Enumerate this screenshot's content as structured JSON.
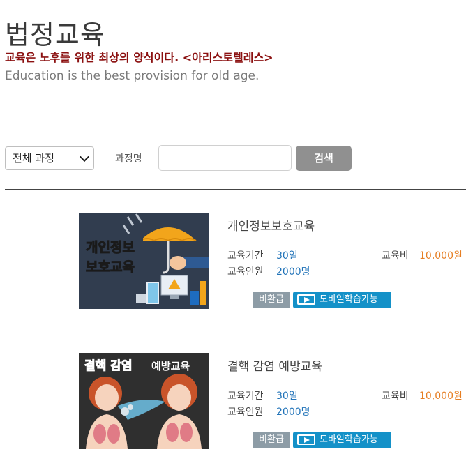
{
  "page": {
    "title": "법정교육",
    "quote_ko": "교육은 노후를 위한 최상의 양식이다. <아리스토텔레스>",
    "quote_en": "Education is the best provision for old age."
  },
  "search": {
    "category_selected": "전체 과정",
    "course_name_label": "과정명",
    "input_value": "",
    "button_label": "검색"
  },
  "labels": {
    "period": "교육기간",
    "headcount": "교육인원",
    "fee": "교육비",
    "non_refundable": "비환급",
    "mobile": "모바일학습가능"
  },
  "courses": [
    {
      "title": "개인정보보호교육",
      "period": "30일",
      "headcount": "2000명",
      "fee": "10,000원",
      "thumb_text": [
        "개인정보",
        "보호교육"
      ]
    },
    {
      "title": "결핵 감염 예방교육",
      "period": "30일",
      "headcount": "2000명",
      "fee": "10,000원",
      "thumb_text": [
        "결핵 감염",
        "예방교육"
      ]
    }
  ],
  "colors": {
    "quote_red": "#8b1010",
    "value_blue": "#2173b8",
    "fee_orange": "#e67e22",
    "badge_gray": "#8d9ca6",
    "badge_blue": "#1491c8"
  }
}
